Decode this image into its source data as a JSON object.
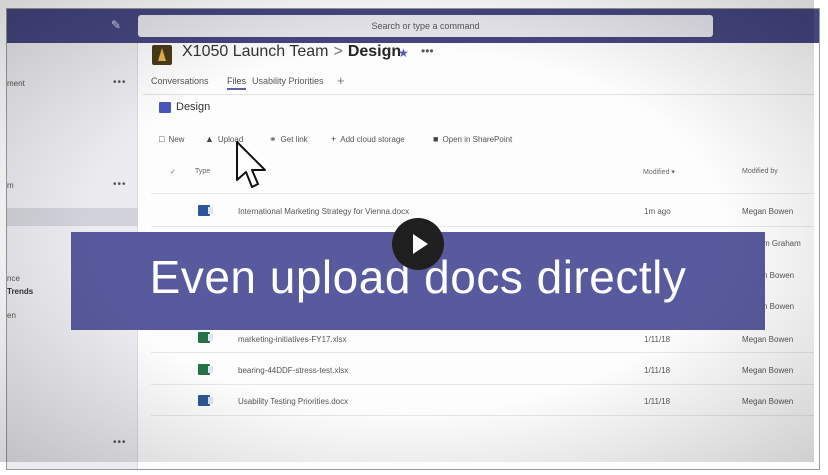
{
  "search": {
    "placeholder": "Search or type a command"
  },
  "left_pane": {
    "fragments": [
      "ment",
      "m",
      "nce",
      "Trends",
      "en"
    ],
    "dots": "•••"
  },
  "header": {
    "team": "X1050 Launch Team",
    "separator": ">",
    "channel": "Design",
    "star": "★",
    "more": "•••"
  },
  "tabs": [
    {
      "label": "Conversations"
    },
    {
      "label": "Files"
    },
    {
      "label": "Usability Priorities"
    }
  ],
  "tab_add": "+",
  "library": {
    "name": "Design"
  },
  "toolbar": {
    "new": "New",
    "upload": "Upload",
    "get_link": "Get link",
    "add_cloud": "Add cloud storage",
    "open_sharepoint": "Open in SharePoint"
  },
  "table": {
    "headers": {
      "type": "Type",
      "modified": "Modified ▾",
      "modified_by": "Modified by"
    },
    "rows": [
      {
        "name": "International Marketing Strategy for Vienna.docx",
        "kind": "docx",
        "modified": "1m ago",
        "by": "Megan Bowen"
      },
      {
        "name": "",
        "kind": "docx",
        "modified": "",
        "by": "m Graham"
      },
      {
        "name": "",
        "kind": "docx",
        "modified": "",
        "by": "n Bowen"
      },
      {
        "name": "",
        "kind": "xlsx",
        "modified": "",
        "by": "n Bowen"
      },
      {
        "name": "marketing-initiatives-FY17.xlsx",
        "kind": "xlsx",
        "modified": "1/11/18",
        "by": "Megan Bowen"
      },
      {
        "name": "bearing-44DDF-stress-test.xlsx",
        "kind": "xlsx",
        "modified": "1/11/18",
        "by": "Megan Bowen"
      },
      {
        "name": "Usability Testing Priorities.docx",
        "kind": "docx",
        "modified": "1/11/18",
        "by": "Megan Bowen"
      }
    ]
  },
  "caption": {
    "text": "Even upload docs directly"
  },
  "colors": {
    "topbar": "#454680",
    "accent": "#6264a7",
    "overlay": "#4b4e96"
  }
}
